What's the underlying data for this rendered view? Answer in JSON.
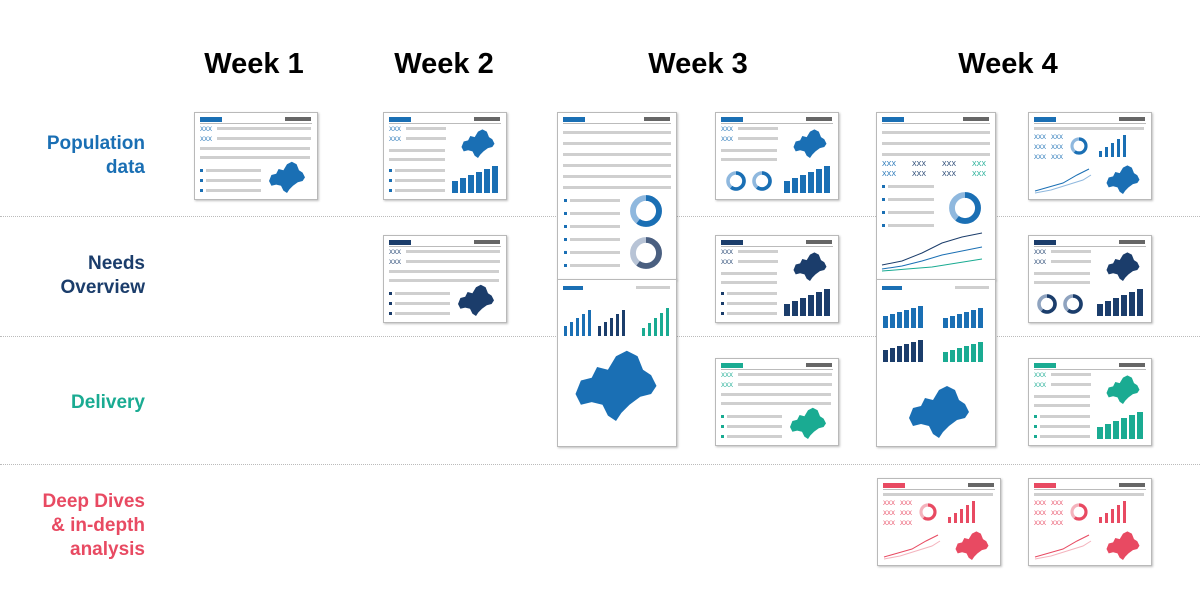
{
  "weeks": [
    "Week 1",
    "Week 2",
    "Week 3",
    "Week 4"
  ],
  "rows": [
    {
      "label": "Population\ndata",
      "color": "#1a6fb4"
    },
    {
      "label": "Needs\nOverview",
      "color": "#1b3d6b"
    },
    {
      "label": "Delivery",
      "color": "#1aab92"
    },
    {
      "label": "Deep Dives\n& in-depth\nanalysis",
      "color": "#e84a62"
    }
  ],
  "colors": {
    "blue": "#1a6fb4",
    "navy": "#1b3d6b",
    "teal": "#1aab92",
    "red": "#e84a62",
    "light_blue": "#8fb8de",
    "gray_bar": "#cfcfcf",
    "header_gray": "#666666"
  },
  "placeholder_text": "XXX"
}
